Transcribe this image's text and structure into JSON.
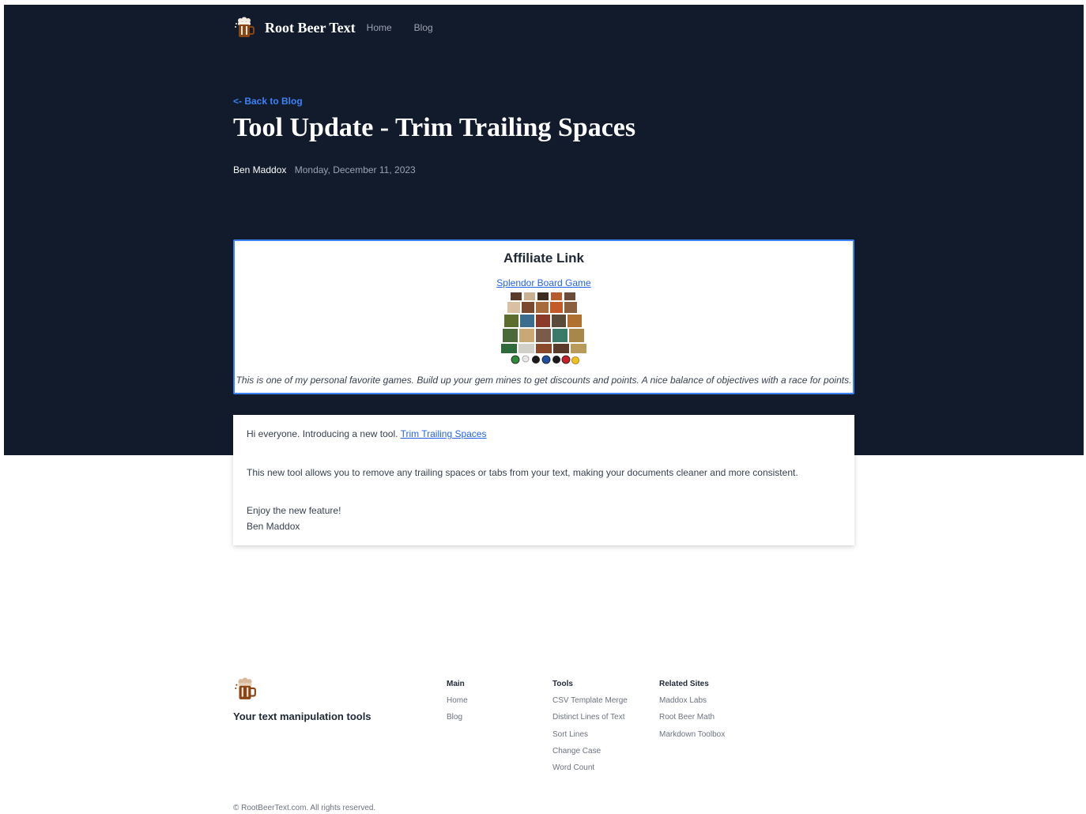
{
  "nav": {
    "brand": "Root Beer Text",
    "links": [
      "Home",
      "Blog"
    ]
  },
  "post": {
    "back_link": "<- Back to Blog",
    "title": "Tool Update - Trim Trailing Spaces",
    "author": "Ben Maddox",
    "date": "Monday, December 11, 2023"
  },
  "affiliate": {
    "heading": "Affiliate Link",
    "link_text": "Splendor Board Game",
    "description": "This is one of my personal favorite games. Build up your gem mines to get discounts and points. A nice balance of objectives with a race for points."
  },
  "content": {
    "intro": "Hi everyone. Introducing a new tool. ",
    "tool_link": "Trim Trailing Spaces",
    "body": "This new tool allows you to remove any trailing spaces or tabs from your text, making your documents cleaner and more consistent.",
    "closing": "Enjoy the new feature!",
    "signature": "Ben Maddox"
  },
  "footer": {
    "tagline": "Your text manipulation tools",
    "columns": [
      {
        "title": "Main",
        "links": [
          "Home",
          "Blog"
        ]
      },
      {
        "title": "Tools",
        "links": [
          "CSV Template Merge",
          "Distinct Lines of Text",
          "Sort Lines",
          "Change Case",
          "Word Count"
        ]
      },
      {
        "title": "Related Sites",
        "links": [
          "Maddox Labs",
          "Root Beer Math",
          "Markdown Toolbox"
        ]
      }
    ],
    "copyright": "© RootBeerText.com. All rights reserved."
  },
  "colors": {
    "hero_bg": "#111b2c",
    "accent": "#3b82f6",
    "link": "#2563eb"
  },
  "icons": [
    "root-beer-mug-icon"
  ]
}
